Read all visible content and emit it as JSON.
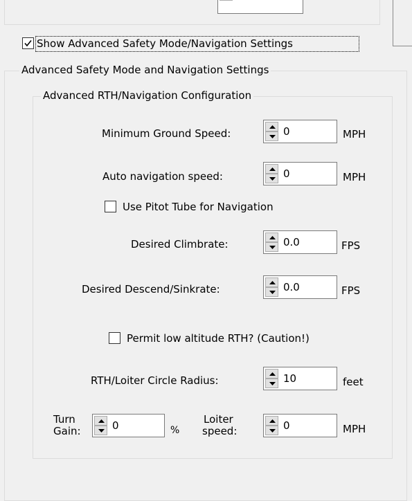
{
  "show_advanced": {
    "label": "Show Advanced Safety Mode/Navigation Settings",
    "checked": true
  },
  "group": {
    "title": "Advanced Safety Mode and Navigation Settings",
    "rth": {
      "title": "Advanced RTH/Navigation Configuration",
      "min_ground_speed": {
        "label": "Minimum Ground Speed:",
        "value": "0",
        "unit": "MPH"
      },
      "auto_nav_speed": {
        "label": "Auto navigation speed:",
        "value": "0",
        "unit": "MPH"
      },
      "use_pitot": {
        "label": "Use Pitot Tube for Navigation",
        "checked": false
      },
      "climbrate": {
        "label": "Desired Climbrate:",
        "value": "0.0",
        "unit": "FPS"
      },
      "descend": {
        "label": "Desired Descend/Sinkrate:",
        "value": "0.0",
        "unit": "FPS"
      },
      "low_alt_rth": {
        "label": "Permit low altitude RTH? (Caution!)",
        "checked": false
      },
      "loiter_radius": {
        "label": "RTH/Loiter Circle Radius:",
        "value": "10",
        "unit": "feet"
      },
      "turn_gain": {
        "label_line1": "Turn",
        "label_line2": "Gain:",
        "value": "0",
        "unit": "%"
      },
      "loiter_speed": {
        "label_line1": "Loiter",
        "label_line2": "speed:",
        "value": "0",
        "unit": "MPH"
      }
    }
  }
}
